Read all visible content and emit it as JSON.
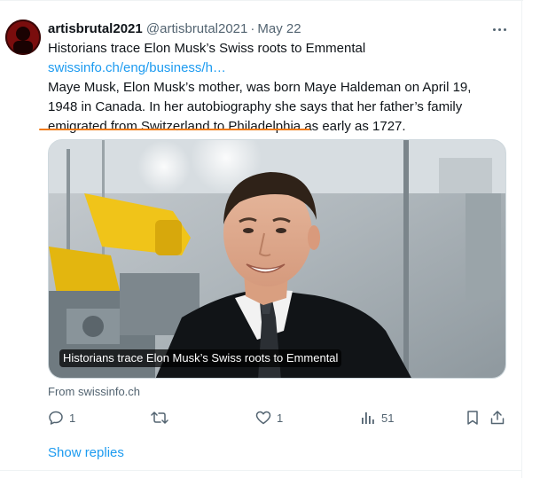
{
  "post": {
    "display_name": "artisbrutal2021",
    "handle": "@artisbrutal2021",
    "separator": "·",
    "date": "May 22",
    "text_line_1": "Historians trace Elon Musk’s Swiss roots to Emmental",
    "link_text": "swissinfo.ch/eng/business/h…",
    "text_line_3": "Maye Musk, Elon Musk’s mother, was born Maye Haldeman on April 19,",
    "text_line_4": "1948  in Canada. In her autobiography she says that her father’s family",
    "text_line_5": "emigrated from Switzerland to Philadelphia as early as 1727."
  },
  "card": {
    "caption": "Historians trace Elon Musk’s Swiss roots to Emmental",
    "source": "From swissinfo.ch"
  },
  "actions": {
    "reply_count": "1",
    "repost_count": "",
    "like_count": "1",
    "view_count": "51"
  },
  "show_replies": "Show replies",
  "colors": {
    "accent": "#1d9bf0",
    "underline": "#f07a13",
    "muted": "#536471"
  }
}
